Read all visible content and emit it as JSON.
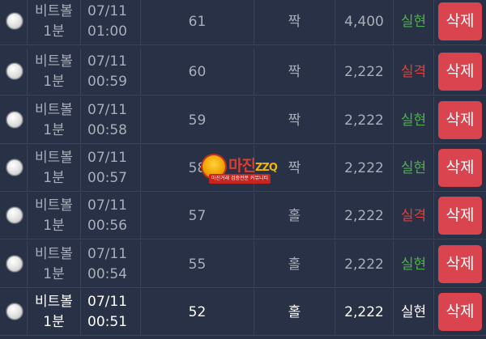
{
  "rows": [
    {
      "game": "비트볼",
      "game_sub": "1분",
      "date": "07/11",
      "time": "01:00",
      "round": "61",
      "pick": "짝",
      "amount": "4,400",
      "result": "실현",
      "result_type": "ok",
      "delete_label": "삭제"
    },
    {
      "game": "비트볼",
      "game_sub": "1분",
      "date": "07/11",
      "time": "00:59",
      "round": "60",
      "pick": "짝",
      "amount": "2,222",
      "result": "실격",
      "result_type": "bad",
      "delete_label": "삭제"
    },
    {
      "game": "비트볼",
      "game_sub": "1분",
      "date": "07/11",
      "time": "00:58",
      "round": "59",
      "pick": "짝",
      "amount": "2,222",
      "result": "실현",
      "result_type": "ok",
      "delete_label": "삭제"
    },
    {
      "game": "비트볼",
      "game_sub": "1분",
      "date": "07/11",
      "time": "00:57",
      "round": "58",
      "pick": "짝",
      "amount": "2,222",
      "result": "실현",
      "result_type": "ok",
      "delete_label": "삭제"
    },
    {
      "game": "비트볼",
      "game_sub": "1분",
      "date": "07/11",
      "time": "00:56",
      "round": "57",
      "pick": "홀",
      "amount": "2,222",
      "result": "실격",
      "result_type": "bad",
      "delete_label": "삭제"
    },
    {
      "game": "비트볼",
      "game_sub": "1분",
      "date": "07/11",
      "time": "00:54",
      "round": "55",
      "pick": "홀",
      "amount": "2,222",
      "result": "실현",
      "result_type": "ok",
      "delete_label": "삭제"
    },
    {
      "game": "비트볼",
      "game_sub": "1분",
      "date": "07/11",
      "time": "00:51",
      "round": "52",
      "pick": "홀",
      "amount": "2,222",
      "result": "실현",
      "result_type": "ok",
      "delete_label": "삭제"
    }
  ],
  "watermark": {
    "brand": "마진",
    "tld": "ZZQ",
    "tagline": "마진거래 검증전문 커뮤니티"
  },
  "colors": {
    "background": "#283145",
    "result_ok": "#4fb04f",
    "result_bad": "#e0403a",
    "delete_button": "#d9444e"
  }
}
